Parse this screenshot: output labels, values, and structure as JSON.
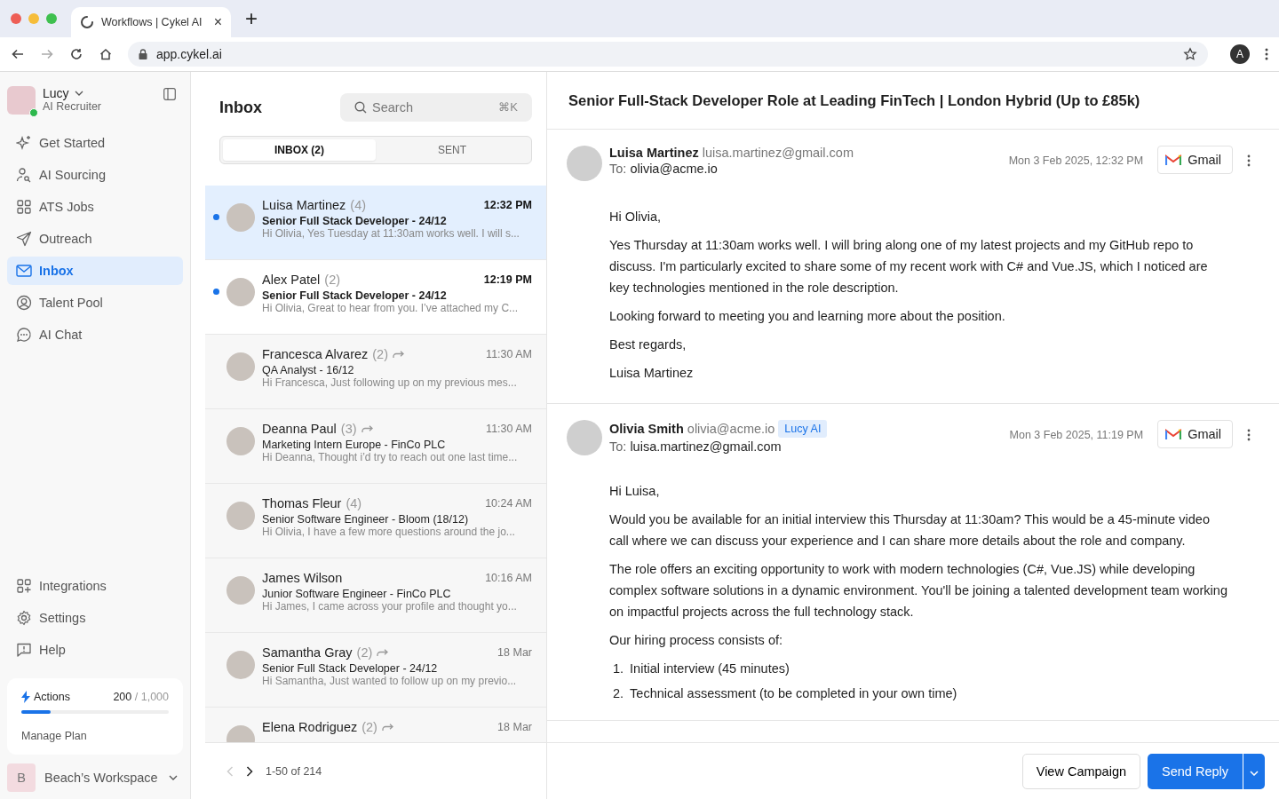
{
  "browser": {
    "tab_title": "Workflows | Cykel AI",
    "close": "×",
    "new_tab": "+",
    "url": "app.cykel.ai",
    "profile": "A"
  },
  "sidebar": {
    "user": {
      "name": "Lucy",
      "role": "AI Recruiter",
      "online": true
    },
    "nav": [
      {
        "label": "Get Started",
        "selected": false
      },
      {
        "label": "AI Sourcing",
        "selected": false
      },
      {
        "label": "ATS Jobs",
        "selected": false
      },
      {
        "label": "Outreach",
        "selected": false
      },
      {
        "label": "Inbox",
        "selected": true
      },
      {
        "label": "Talent Pool",
        "selected": false
      },
      {
        "label": "AI Chat",
        "selected": false
      }
    ],
    "bottom_nav": [
      {
        "label": "Integrations"
      },
      {
        "label": "Settings"
      },
      {
        "label": "Help"
      }
    ],
    "usage": {
      "label": "Actions",
      "used": "200",
      "limit": "/ 1,000",
      "level": 0.2,
      "link": "Manage Plan"
    },
    "workspace": {
      "initial": "B",
      "name": "Beach’s Workspace"
    }
  },
  "inbox": {
    "title": "Inbox",
    "search": {
      "placeholder": "Search",
      "shortcut": "⌘K"
    },
    "tabs": [
      {
        "label": "INBOX (2)",
        "selected": true
      },
      {
        "label": "SENT",
        "selected": false
      }
    ],
    "threads": [
      {
        "name": "Luisa Martinez",
        "count": "(4)",
        "time": "12:32 PM",
        "subject": "Senior Full Stack Developer - 24/12",
        "preview": "Hi Olivia, Yes Tuesday at 11:30am works well. I will s...",
        "unread": true,
        "selected": true,
        "replied": false
      },
      {
        "name": "Alex Patel",
        "count": "(2)",
        "time": "12:19 PM",
        "subject": "Senior Full Stack Developer - 24/12",
        "preview": "Hi Olivia, Great to hear from you. I’ve attached my C...",
        "unread": true,
        "selected": false,
        "replied": false
      },
      {
        "name": "Francesca Alvarez",
        "count": "(2)",
        "time": "11:30 AM",
        "subject": "QA Analyst - 16/12",
        "preview": "Hi Francesca, Just following up on my previous mes...",
        "unread": false,
        "selected": false,
        "replied": true
      },
      {
        "name": "Deanna Paul",
        "count": "(3)",
        "time": "11:30 AM",
        "subject": "Marketing Intern Europe - FinCo PLC",
        "preview": "Hi Deanna, Thought i’d try to reach out one last time...",
        "unread": false,
        "selected": false,
        "replied": true
      },
      {
        "name": "Thomas Fleur",
        "count": "(4)",
        "time": "10:24 AM",
        "subject": "Senior Software Engineer - Bloom (18/12)",
        "preview": "Hi Olivia, I have a few more questions around the jo...",
        "unread": false,
        "selected": false,
        "replied": false
      },
      {
        "name": "James Wilson",
        "time": "10:16 AM",
        "subject": "Junior Software Engineer - FinCo PLC",
        "preview": "Hi James, I came across your profile and thought yo...",
        "unread": false,
        "selected": false,
        "replied": false
      },
      {
        "name": "Samantha Gray",
        "count": "(2)",
        "time": "18 Mar",
        "subject": "Senior Full Stack Developer - 24/12",
        "preview": "Hi Samantha, Just wanted to follow up on my previo...",
        "unread": false,
        "selected": false,
        "replied": true
      },
      {
        "name": "Elena Rodriguez",
        "count": "(2)",
        "time": "18 Mar",
        "unread": false,
        "selected": false,
        "replied": true
      }
    ],
    "pagination": {
      "range": "1-50 of 214"
    }
  },
  "thread": {
    "title": "Senior Full-Stack Developer Role at Leading FinTech | London Hybrid (Up to £85k)",
    "messages": [
      {
        "sender": "Luisa Martinez",
        "email": "luisa.martinez@gmail.com",
        "to_label": "To:",
        "to": "olivia@acme.io",
        "date": "Mon 3 Feb 2025, 12:32 PM",
        "source": "Gmail",
        "body": [
          {
            "kind": "paragraph",
            "text": "Hi Olivia,"
          },
          {
            "kind": "paragraph",
            "text": "Yes Thursday at 11:30am works well. I will bring along one of my latest projects and my GitHub repo to discuss. I'm particularly excited to share some of my recent work with C# and Vue.JS, which I noticed are key technologies mentioned in the role description."
          },
          {
            "kind": "paragraph",
            "text": "Looking forward to meeting you and learning more about the position."
          },
          {
            "kind": "paragraph",
            "text": "Best regards,"
          },
          {
            "kind": "paragraph",
            "text": "Luisa Martinez"
          }
        ]
      },
      {
        "sender": "Olivia Smith",
        "email": "olivia@acme.io",
        "tag": "Lucy AI",
        "to_label": "To:",
        "to": "luisa.martinez@gmail.com",
        "date": "Mon 3 Feb 2025, 11:19 PM",
        "source": "Gmail",
        "body": [
          {
            "kind": "paragraph",
            "text": "Hi Luisa,"
          },
          {
            "kind": "paragraph",
            "text": "Would you be available for an initial interview this Thursday at 11:30am? This would be a 45-minute video call where we can discuss your experience and I can share more details about the role and company."
          },
          {
            "kind": "paragraph",
            "text": "The role offers an exciting opportunity to work with modern technologies (C#, Vue.JS) while developing complex software solutions in a dynamic environment. You'll be joining a talented development team working on impactful projects across the full technology stack."
          },
          {
            "kind": "paragraph",
            "text": "Our hiring process consists of:"
          },
          {
            "kind": "list_item",
            "number": "1.",
            "text": "Initial interview (45 minutes)"
          },
          {
            "kind": "list_item",
            "number": "2.",
            "text": "Technical assessment (to be completed in your own time)"
          }
        ]
      }
    ],
    "actions": [
      {
        "label": "View Campaign",
        "kind": "secondary"
      },
      {
        "label": "Send Reply",
        "kind": "primary"
      }
    ]
  }
}
